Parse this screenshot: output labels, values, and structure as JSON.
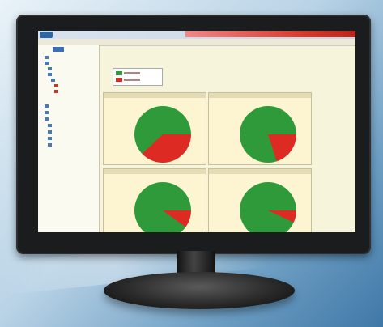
{
  "menu": {
    "items": [
      "",
      "",
      "",
      "",
      ""
    ]
  },
  "sidebar": {
    "items": [
      {
        "label": ""
      },
      {
        "label": ""
      },
      {
        "label": ""
      },
      {
        "label": ""
      },
      {
        "label": ""
      },
      {
        "label": ""
      },
      {
        "label": ""
      },
      {
        "label": ""
      },
      {
        "label": ""
      },
      {
        "label": ""
      },
      {
        "label": ""
      },
      {
        "label": ""
      },
      {
        "label": ""
      },
      {
        "label": ""
      }
    ]
  },
  "content": {
    "title": "",
    "lines": [
      "",
      "",
      ""
    ]
  },
  "panels": [
    {
      "title": "",
      "green_fraction": 0.62
    },
    {
      "title": "",
      "green_fraction": 0.8
    },
    {
      "title": "",
      "green_fraction": 0.9
    },
    {
      "title": "",
      "green_fraction": 0.93
    }
  ],
  "colors": {
    "pie_green": "#2f9a3a",
    "pie_red": "#dd2a22",
    "sidebar_link": "#2c4f7b",
    "window_accent": "#d23b2a"
  }
}
